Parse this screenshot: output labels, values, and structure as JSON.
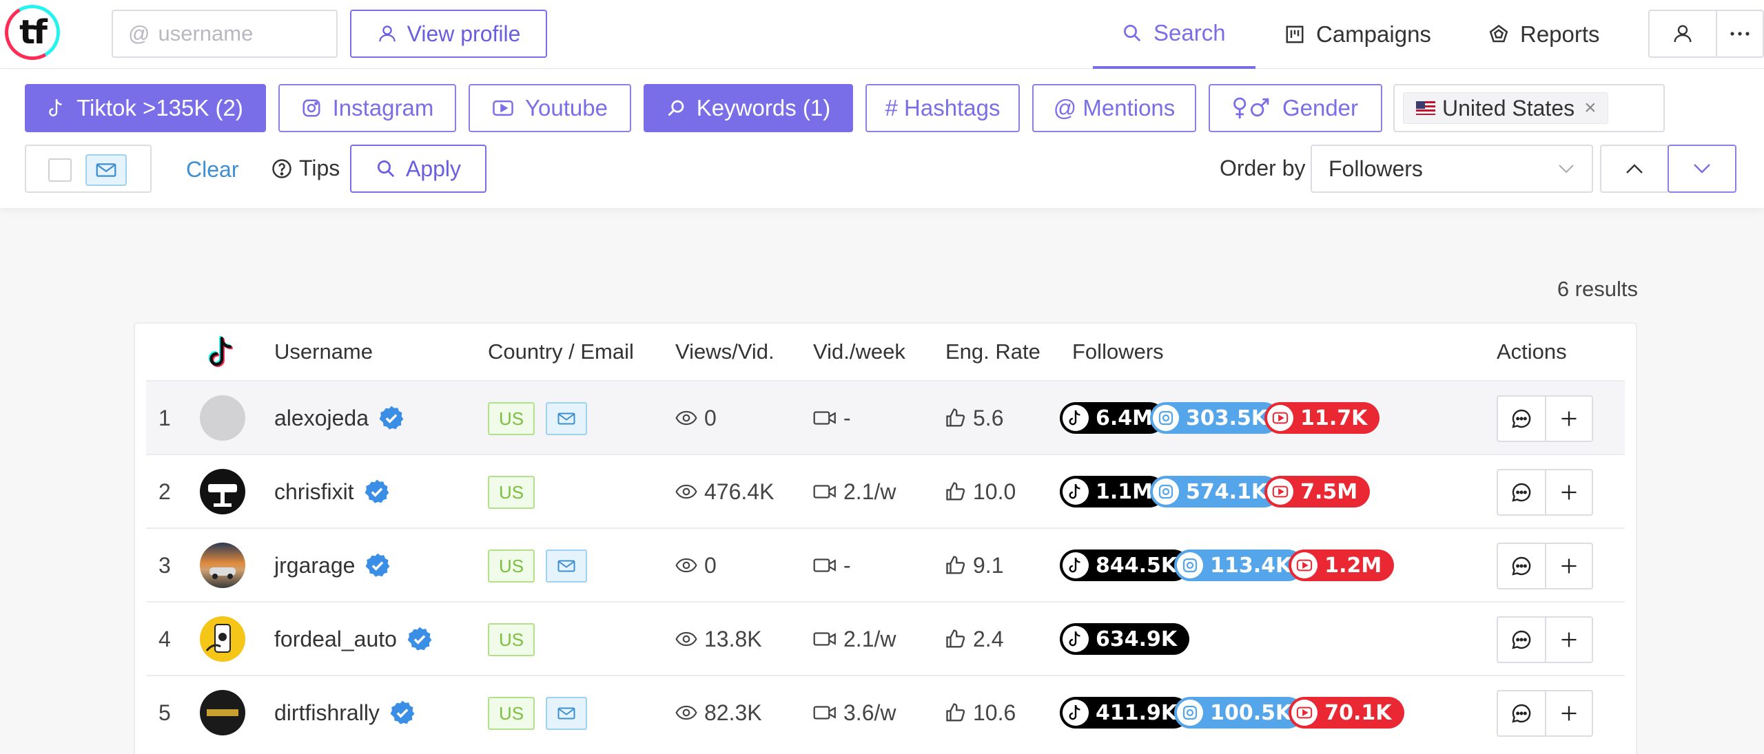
{
  "header": {
    "logo_text": "tf",
    "username_placeholder": "username",
    "view_profile_label": "View profile",
    "nav": [
      {
        "label": "Search"
      },
      {
        "label": "Campaigns"
      },
      {
        "label": "Reports"
      }
    ],
    "accent_color": "#7a6ee8"
  },
  "filters": {
    "chips": [
      {
        "label": "Tiktok >135K (2)",
        "style": "filled",
        "icon": "tiktok-icon"
      },
      {
        "label": "Instagram",
        "style": "outline",
        "icon": "instagram-icon"
      },
      {
        "label": "Youtube",
        "style": "outline",
        "icon": "youtube-icon"
      },
      {
        "label": "Keywords (1)",
        "style": "filled",
        "icon": "search-icon"
      },
      {
        "label": "# Hashtags",
        "style": "outline"
      },
      {
        "label": "@ Mentions",
        "style": "outline"
      },
      {
        "label": "Gender",
        "style": "outline",
        "icon": "gender-icon"
      }
    ],
    "country_tag": "United States",
    "clear_label": "Clear",
    "tips_label": "Tips",
    "apply_label": "Apply",
    "order_by_label": "Order by",
    "order_by_value": "Followers"
  },
  "results": {
    "count_text": "6 results",
    "columns": [
      "Username",
      "Country / Email",
      "Views/Vid.",
      "Vid./week",
      "Eng. Rate",
      "Followers",
      "Actions"
    ],
    "rows": [
      {
        "rank": "1",
        "username": "alexojeda",
        "country": "US",
        "has_email": true,
        "views": "0",
        "vid_week": "-",
        "eng_rate": "5.6",
        "followers": {
          "tiktok": "6.4M",
          "instagram": "303.5K",
          "youtube": "11.7K"
        }
      },
      {
        "rank": "2",
        "username": "chrisfixit",
        "country": "US",
        "has_email": false,
        "views": "476.4K",
        "vid_week": "2.1/w",
        "eng_rate": "10.0",
        "followers": {
          "tiktok": "1.1M",
          "instagram": "574.1K",
          "youtube": "7.5M"
        }
      },
      {
        "rank": "3",
        "username": "jrgarage",
        "country": "US",
        "has_email": true,
        "views": "0",
        "vid_week": "-",
        "eng_rate": "9.1",
        "followers": {
          "tiktok": "844.5K",
          "instagram": "113.4K",
          "youtube": "1.2M"
        }
      },
      {
        "rank": "4",
        "username": "fordeal_auto",
        "country": "US",
        "has_email": false,
        "views": "13.8K",
        "vid_week": "2.1/w",
        "eng_rate": "2.4",
        "followers": {
          "tiktok": "634.9K"
        }
      },
      {
        "rank": "5",
        "username": "dirtfishrally",
        "country": "US",
        "has_email": true,
        "views": "82.3K",
        "vid_week": "3.6/w",
        "eng_rate": "10.6",
        "followers": {
          "tiktok": "411.9K",
          "instagram": "100.5K",
          "youtube": "70.1K"
        }
      }
    ]
  },
  "colors": {
    "tiktok_pill": "#000000",
    "instagram_pill": "#55a5ea",
    "youtube_pill": "#ea2833",
    "country_tag": "#7cbf3f",
    "verified": "#3a8ee6"
  }
}
